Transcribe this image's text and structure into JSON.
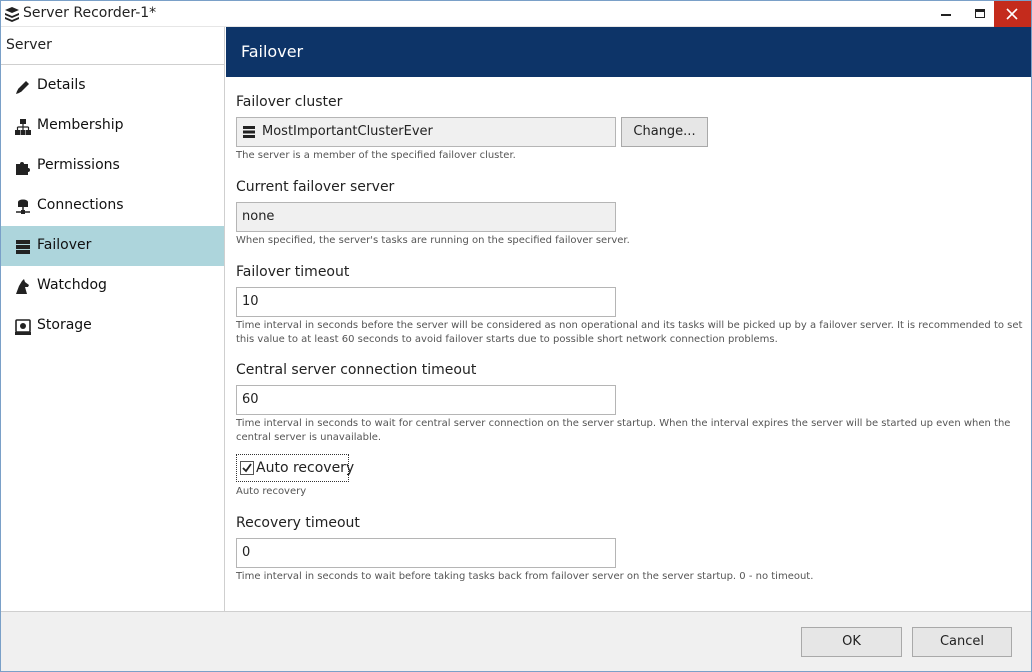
{
  "window": {
    "title": "Server Recorder-1*",
    "close_color": "#c42b1c"
  },
  "sidebar": {
    "header": "Server",
    "active_color": "#add5dc",
    "items": [
      {
        "label": "Details",
        "icon": "pencil-icon"
      },
      {
        "label": "Membership",
        "icon": "hierarchy-icon"
      },
      {
        "label": "Permissions",
        "icon": "puzzle-icon"
      },
      {
        "label": "Connections",
        "icon": "network-icon"
      },
      {
        "label": "Failover",
        "icon": "server-stack-icon",
        "active": true
      },
      {
        "label": "Watchdog",
        "icon": "dog-icon"
      },
      {
        "label": "Storage",
        "icon": "storage-icon"
      }
    ]
  },
  "main": {
    "title": "Failover",
    "header_color": "#0d3468",
    "failover_cluster": {
      "label": "Failover cluster",
      "value": "MostImportantClusterEver",
      "change_label": "Change...",
      "hint": "The server is a member of the specified failover cluster."
    },
    "current_failover_server": {
      "label": "Current failover server",
      "value": "none",
      "hint": "When specified, the server's tasks are running on the specified failover server."
    },
    "failover_timeout": {
      "label": "Failover timeout",
      "value": "10",
      "hint": "Time interval in seconds before the server will be considered as non operational and its tasks will be picked up by a failover server. It is recommended to set this value to at least 60 seconds to avoid failover starts due to possible short network connection problems."
    },
    "central_timeout": {
      "label": "Central server connection timeout",
      "value": "60",
      "hint": "Time interval in seconds to wait for central server connection on the server startup.  When the interval expires the server will be started up even when the central server is unavailable."
    },
    "auto_recovery": {
      "label": "Auto recovery",
      "checked": true,
      "hint": "Auto recovery"
    },
    "recovery_timeout": {
      "label": "Recovery timeout",
      "value": "0",
      "hint": "Time interval in seconds to wait before taking tasks back from failover server on the server startup.  0 - no timeout."
    }
  },
  "footer": {
    "ok_label": "OK",
    "cancel_label": "Cancel"
  }
}
